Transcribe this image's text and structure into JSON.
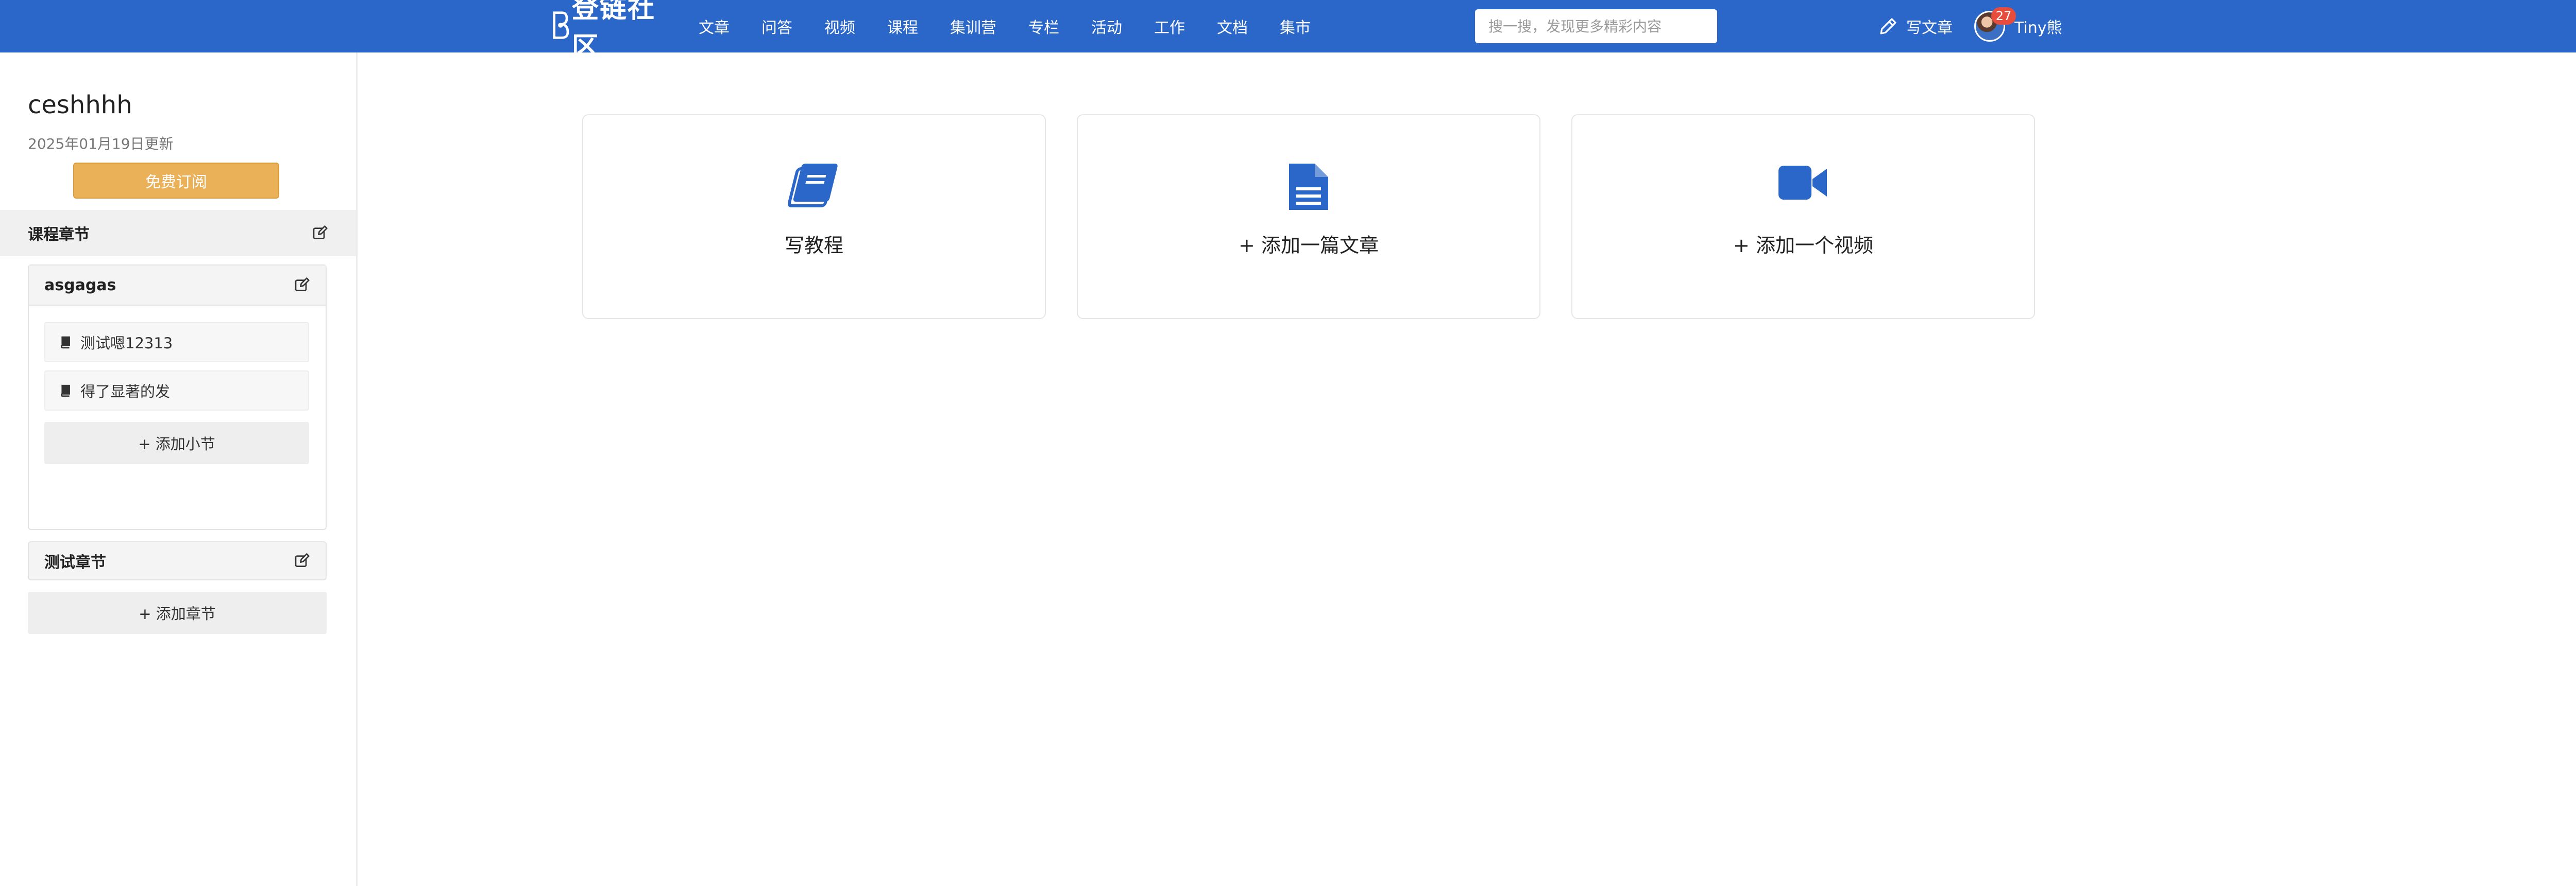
{
  "header": {
    "logo_text": "登链社区",
    "nav": [
      "文章",
      "问答",
      "视频",
      "课程",
      "集训营",
      "专栏",
      "活动",
      "工作",
      "文档",
      "集市"
    ],
    "search_placeholder": "搜一搜，发现更多精彩内容",
    "write_label": "写文章",
    "notification_count": "27",
    "user_name": "Tiny熊"
  },
  "sidebar": {
    "course_title": "ceshhhh",
    "updated": "2025年01月19日更新",
    "subscribe_label": "免费订阅",
    "chapters_heading": "课程章节",
    "chapters": [
      {
        "title": "asgagas",
        "lessons": [
          "测试嗯12313",
          "得了显著的发"
        ],
        "add_lesson_label": "+ 添加小节"
      },
      {
        "title": "测试章节"
      }
    ],
    "add_chapter_label": "+ 添加章节"
  },
  "cards": [
    {
      "label": "写教程",
      "icon": "book-icon"
    },
    {
      "label": "+ 添加一篇文章",
      "icon": "document-icon"
    },
    {
      "label": "+ 添加一个视频",
      "icon": "video-camera-icon"
    }
  ],
  "colors": {
    "brand_blue": "#2a67c8",
    "subscribe_orange": "#ebb159"
  }
}
